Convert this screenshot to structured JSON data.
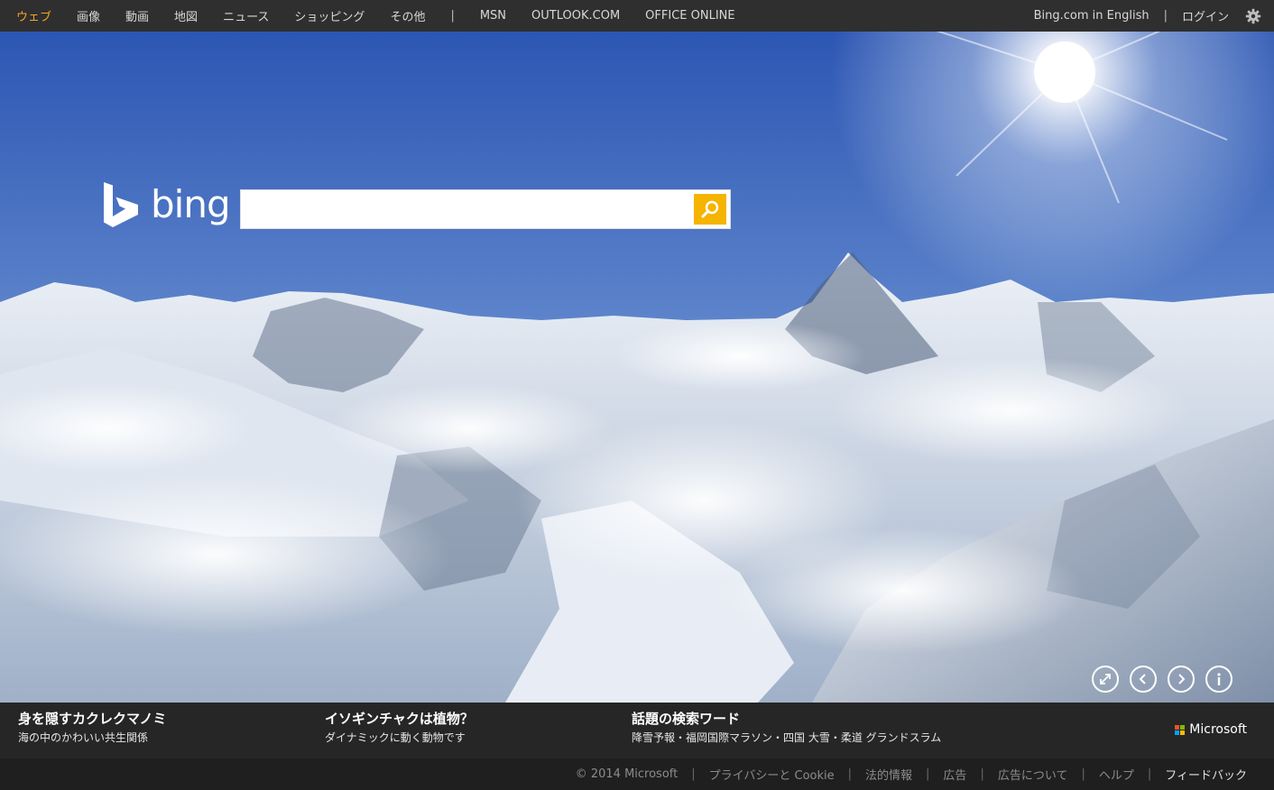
{
  "nav": {
    "left": [
      {
        "label": "ウェブ",
        "active": true
      },
      {
        "label": "画像"
      },
      {
        "label": "動画"
      },
      {
        "label": "地図"
      },
      {
        "label": "ニュース"
      },
      {
        "label": "ショッピング"
      },
      {
        "label": "その他"
      }
    ],
    "separator": "|",
    "ext": [
      "MSN",
      "OUTLOOK.COM",
      "OFFICE ONLINE"
    ],
    "english_link": "Bing.com in English",
    "login": "ログイン",
    "settings_icon": "gear-icon",
    "active_color": "#f5a623"
  },
  "logo": {
    "word": "bing"
  },
  "search": {
    "value": "",
    "placeholder": "",
    "button_color": "#f4b400",
    "button_icon": "search-icon"
  },
  "image_controls": [
    "expand-icon",
    "previous-icon",
    "next-icon",
    "info-icon"
  ],
  "captions": [
    {
      "title": "身を隠すカクレクマノミ",
      "subtitle": "海の中のかわいい共生関係"
    },
    {
      "title": "イソギンチャクは植物？",
      "subtitle": "ダイナミックに動く動物です"
    },
    {
      "title": "話題の検索ワード",
      "subtitle": "降雪予報・福岡国際マラソン・四国 大雪・柔道 グランドスラム"
    }
  ],
  "brand": {
    "name": "Microsoft",
    "colors": [
      "#f25022",
      "#7fba00",
      "#00a4ef",
      "#ffb900"
    ]
  },
  "footer": {
    "copyright": "© 2014 Microsoft",
    "links": [
      "プライバシーと Cookie",
      "法的情報",
      "広告",
      "広告について",
      "ヘルプ",
      "フィードバック"
    ]
  }
}
